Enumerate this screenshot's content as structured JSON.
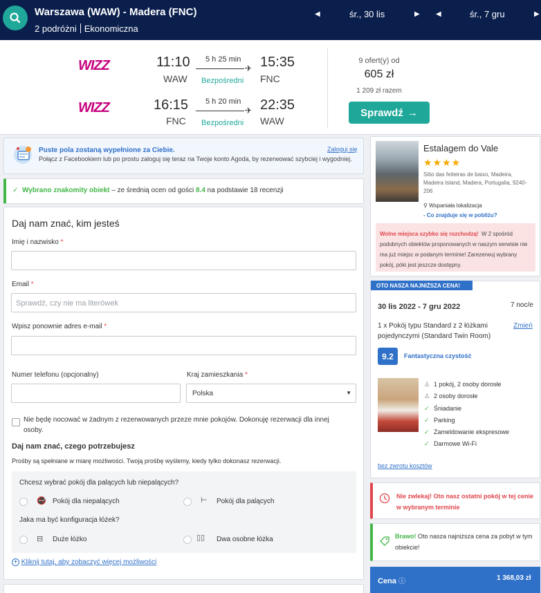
{
  "topbar": {
    "route": "Warszawa (WAW) - Madera (FNC)",
    "passengers": "2 podróżni",
    "cabin": "Ekonomiczna",
    "depart_date": "śr., 30 lis",
    "return_date": "śr., 7 gru"
  },
  "flights": {
    "outbound": {
      "airline": "WIZZ",
      "dep_time": "11:10",
      "dep_iata": "WAW",
      "arr_time": "15:35",
      "arr_iata": "FNC",
      "duration": "5 h 25 min",
      "stops": "Bezpośredni"
    },
    "inbound": {
      "airline": "WIZZ",
      "dep_time": "16:15",
      "dep_iata": "FNC",
      "arr_time": "22:35",
      "arr_iata": "WAW",
      "duration": "5 h 20 min",
      "stops": "Bezpośredni"
    },
    "offers": "9 ofert(y) od",
    "price": "605 zł",
    "total": "1 209 zł razem",
    "check_label": "Sprawdź"
  },
  "facebook": {
    "title": "Puste pola zostaną wypełnione za Ciebie.",
    "text": "Połącz z Facebookiem lub po prostu zaloguj się teraz na Twoje konto Agoda, by rezerwować szybciej i wygodniej.",
    "login": "Zaloguj się"
  },
  "selection": {
    "strong": "Wybrano znakomity obiekt",
    "text_before": " – ze średnią ocen od gości ",
    "score": "8.4",
    "text_after": " na podstawie 18 recenzji"
  },
  "form": {
    "title": "Daj nam znać, kim jesteś",
    "name_label": "Imię i nazwisko",
    "email_label": "Email",
    "email_placeholder": "Sprawdź, czy nie ma literówek",
    "email2_label": "Wpisz ponownie adres e-mail",
    "phone_label": "Numer telefonu (opcjonalny)",
    "country_label": "Kraj zamieszkania",
    "country_value": "Polska",
    "not_staying": "Nie będę nocować w żadnym z rezerwowanych przeze mnie pokojów. Dokonuję rezerwacji dla innej osoby.",
    "needs_title": "Daj nam znać, czego potrzebujesz",
    "needs_text": "Prośby są spełniane w miarę możliwości. Twoją prośbę wyślemy, kiedy tylko dokonasz rezerwacji.",
    "smoking_q": "Chcesz wybrać pokój dla palących lub niepalących?",
    "non_smoking": "Pokój dla niepalących",
    "smoking": "Pokój dla palących",
    "bed_q": "Jaka ma być konfiguracja łóżek?",
    "large_bed": "Duże łóżko",
    "twin_beds": "Dwa osobne łóżka",
    "more_link": "Kliknij tutaj, aby zobaczyć więcej możliwości",
    "required_mark": "*"
  },
  "hotel": {
    "name": "Estalagem do Vale",
    "stars": "★★★★",
    "address": "Sitio das feiteiras de baixo, Madeira, Madeira Island, Madera, Portugalia, 9240-206",
    "location_label": "Wspaniała lokalizacja",
    "nearby_link": "- Co znajduje się w pobliżu?",
    "alert_strong": "Wolne miejsca szybko się rozchodzą!",
    "alert_text": "W 2 spośród podobnych obiektów proponowanych w naszym serwisie nie ma już miejsc w podanym terminie! Zarezerwuj wybrany pokój, póki jest jeszcze dostępny."
  },
  "booking": {
    "badge": "OTO NASZA NAJNIŻSZA CENA!",
    "dates": "30 lis 2022 - 7 gru 2022",
    "nights": "7 noc/e",
    "room": "1 x Pokój typu Standard z 2 łóżkami pojedynczymi (Standard Twin Room)",
    "change": "Zmień",
    "score": "9.2",
    "score_label": "Fantastyczna czystość",
    "guests_rooms": "1 pokój, 2 osoby dorosłe",
    "adults": "2 osoby dorosłe",
    "amenities": [
      "Śniadanie",
      "Parking",
      "Zameldowanie ekspresowe",
      "Darmowe Wi-Fi"
    ],
    "refund": "bez zwrotu kosztów"
  },
  "urgent": {
    "text": "Nie zwlekaj! Oto nasz ostatni pokój w tej cenie w wybranym terminie"
  },
  "bravo": {
    "strong": "Brawo!",
    "text": " Oto nasza najniższa cena za pobyt w tym obiekcie!"
  },
  "price_box": {
    "label": "Cena",
    "value": "1 368,03 zł"
  },
  "colors": {
    "navy": "#0b1f4d",
    "teal": "#1fa89a",
    "blue": "#2f70c8",
    "green": "#43b649",
    "red": "#e0454c",
    "wizz": "#c6007e"
  }
}
